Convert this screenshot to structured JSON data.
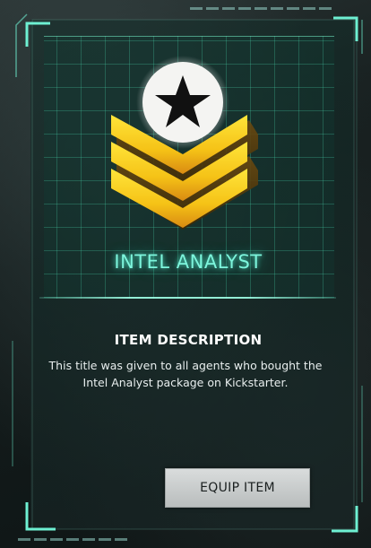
{
  "item": {
    "name": "INTEL ANALYST",
    "icon": "sergeant-chevron-star-insignia"
  },
  "description": {
    "title": "ITEM DESCRIPTION",
    "text": "This title was given to all agents who bought the Intel Analyst package on Kickstarter."
  },
  "actions": {
    "equip_label": "EQUIP ITEM"
  },
  "colors": {
    "accent": "#7df5dc",
    "frame": "#5fe0c4",
    "insignia_gold": "#f2c21b",
    "button_bg": "#c9cccc"
  }
}
